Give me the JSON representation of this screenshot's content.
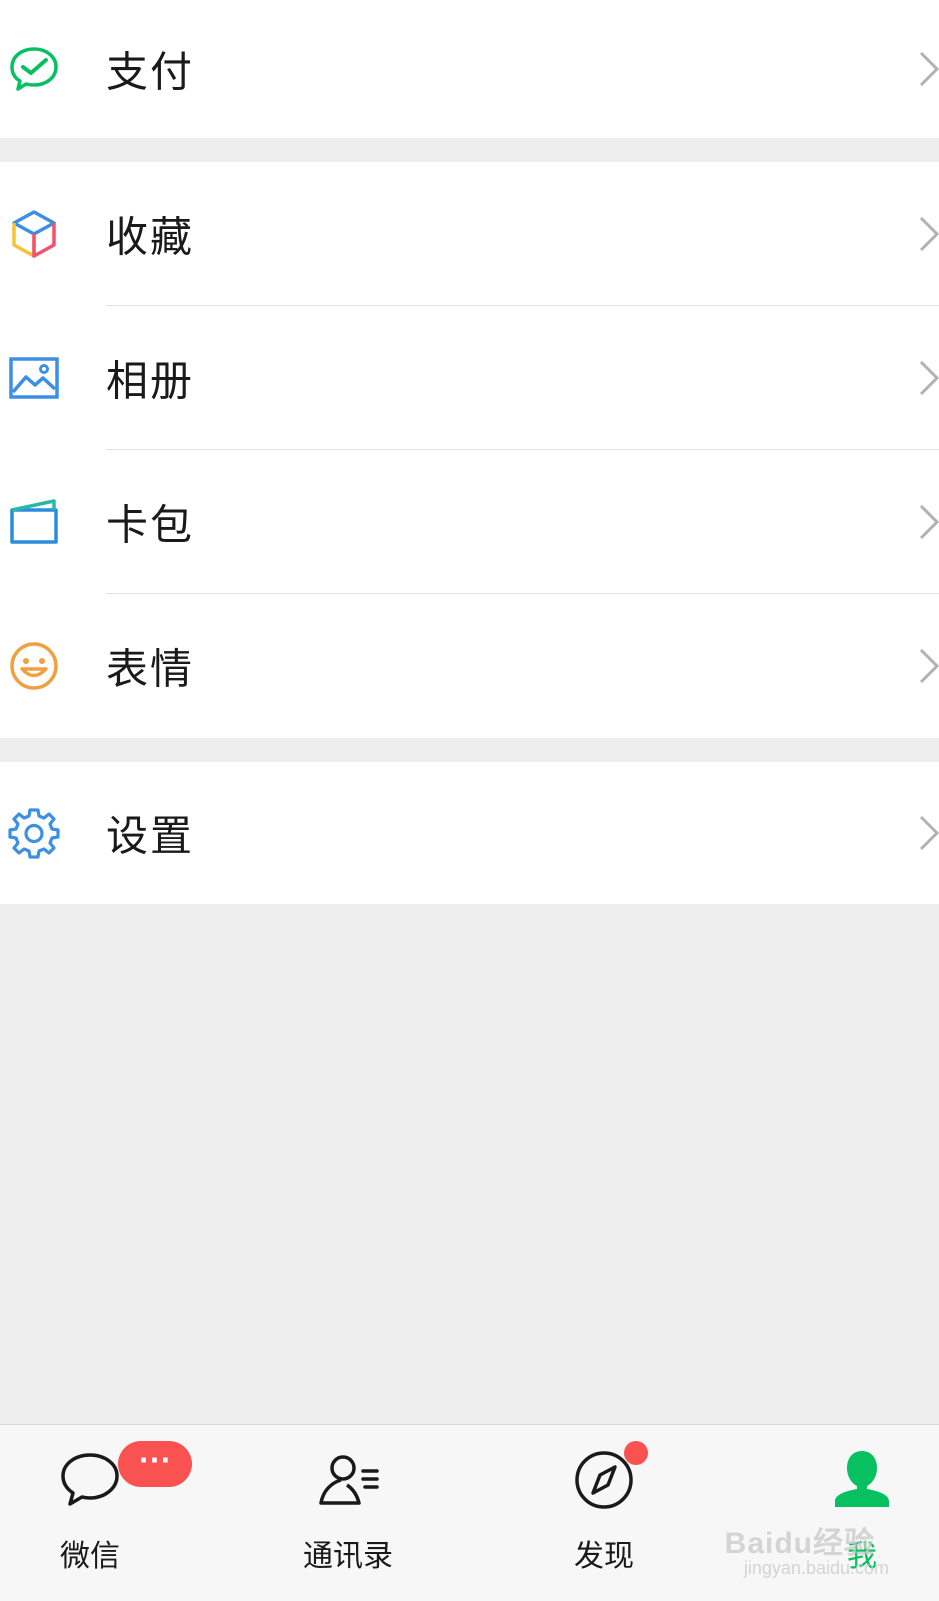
{
  "menu": {
    "group1": [
      {
        "label": "支付",
        "icon": "wechat-pay-icon"
      }
    ],
    "group2": [
      {
        "label": "收藏",
        "icon": "favorites-cube-icon"
      },
      {
        "label": "相册",
        "icon": "album-picture-icon"
      },
      {
        "label": "卡包",
        "icon": "card-wallet-icon"
      },
      {
        "label": "表情",
        "icon": "smiley-face-icon"
      }
    ],
    "group3": [
      {
        "label": "设置",
        "icon": "gear-icon"
      }
    ]
  },
  "tabbar": {
    "tabs": [
      {
        "label": "微信",
        "icon": "chat-bubble-icon",
        "badge": "···"
      },
      {
        "label": "通讯录",
        "icon": "contacts-icon"
      },
      {
        "label": "发现",
        "icon": "compass-icon",
        "dot": true
      },
      {
        "label": "我",
        "icon": "person-icon",
        "active": true
      }
    ]
  },
  "watermark": {
    "text": "Baidu经验",
    "sub": "jingyan.baidu.com"
  },
  "colors": {
    "accent_green": "#07c160",
    "badge_red": "#fa5151",
    "background": "#ededed"
  }
}
